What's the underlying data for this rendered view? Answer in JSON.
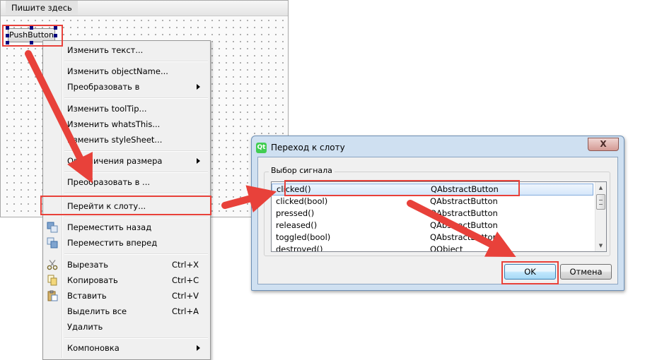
{
  "form": {
    "menubar_placeholder": "Пишите здесь",
    "pushbutton_label": "PushButton"
  },
  "context_menu": {
    "items": [
      {
        "label": "Изменить текст..."
      },
      {
        "label": "Изменить objectName..."
      },
      {
        "label": "Преобразовать в",
        "submenu": true
      },
      {
        "label": "Изменить toolTip..."
      },
      {
        "label": "Изменить whatsThis..."
      },
      {
        "label": "Изменить styleSheet..."
      },
      {
        "label": "Ограничения размера",
        "submenu": true
      },
      {
        "label": "Преобразовать в ..."
      },
      {
        "label": "Перейти к слоту..."
      },
      {
        "label": "Переместить назад",
        "icon": "send-backward-icon"
      },
      {
        "label": "Переместить вперед",
        "icon": "bring-forward-icon"
      },
      {
        "label": "Вырезать",
        "shortcut": "Ctrl+X",
        "icon": "scissors-icon"
      },
      {
        "label": "Копировать",
        "shortcut": "Ctrl+C",
        "icon": "copy-icon"
      },
      {
        "label": "Вставить",
        "shortcut": "Ctrl+V",
        "icon": "paste-icon"
      },
      {
        "label": "Выделить все",
        "shortcut": "Ctrl+A"
      },
      {
        "label": "Удалить"
      },
      {
        "label": "Компоновка",
        "submenu": true
      }
    ]
  },
  "dialog": {
    "title": "Переход к слоту",
    "close_glyph": "X",
    "group_title": "Выбор сигнала",
    "signals": [
      {
        "signal": "clicked()",
        "class": "QAbstractButton",
        "selected": true
      },
      {
        "signal": "clicked(bool)",
        "class": "QAbstractButton"
      },
      {
        "signal": "pressed()",
        "class": "QAbstractButton"
      },
      {
        "signal": "released()",
        "class": "QAbstractButton"
      },
      {
        "signal": "toggled(bool)",
        "class": "QAbstractButton"
      },
      {
        "signal": "destroyed()",
        "class": "QObject"
      }
    ],
    "ok_label": "OK",
    "cancel_label": "Отмена"
  },
  "colors": {
    "annotation_red": "#e8413a",
    "selection_blue": "#84acdd",
    "dialog_frame": "#cfe0f1"
  }
}
